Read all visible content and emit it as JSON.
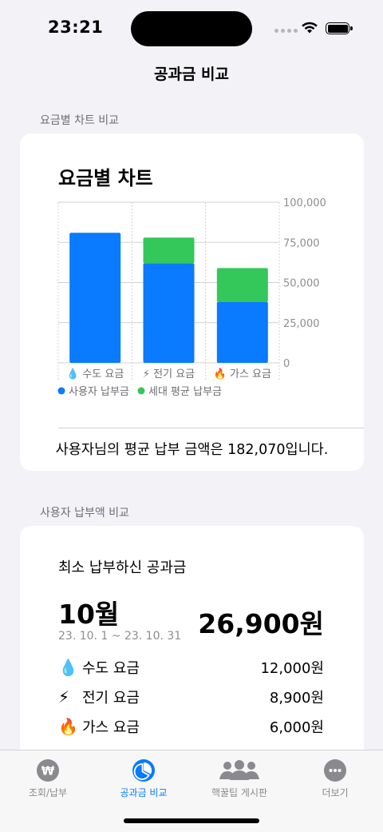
{
  "status": {
    "time": "23:21"
  },
  "nav": {
    "title": "공과금 비교"
  },
  "chart_section": {
    "label": "요금별 차트 비교",
    "summary": "사용자님의 평균 납부 금액은 182,070입니다."
  },
  "chart_data": {
    "type": "bar",
    "stacked": true,
    "title": "요금별 차트",
    "categories": [
      {
        "icon": "💧",
        "label": "수도 요금"
      },
      {
        "icon": "⚡",
        "label": "전기 요금"
      },
      {
        "icon": "🔥",
        "label": "가스 요금"
      }
    ],
    "series": [
      {
        "name": "사용자 납부금",
        "color": "#0a7aff",
        "values": [
          81000,
          62000,
          38000
        ]
      },
      {
        "name": "세대 평균 납부금",
        "color": "#34c759",
        "values": [
          0,
          16000,
          21000
        ]
      }
    ],
    "ylim": [
      0,
      100000
    ],
    "y_ticks": [
      "100,000",
      "75,000",
      "50,000",
      "25,000",
      "0"
    ],
    "y_tick_values": [
      100000,
      75000,
      50000,
      25000,
      0
    ],
    "grid": true,
    "legend_position": "bottom-left"
  },
  "payment_section": {
    "label": "사용자 납부액 비교",
    "card_title": "최소 납부하신 공과금",
    "month": "10월",
    "period": "23. 10. 1 ~ 23. 10. 31",
    "total": "26,900원",
    "items": [
      {
        "icon": "💧",
        "label": "수도 요금",
        "amount": "12,000원"
      },
      {
        "icon": "⚡",
        "label": "전기 요금",
        "amount": "8,900원"
      },
      {
        "icon": "🔥",
        "label": "가스 요금",
        "amount": "6,000원"
      }
    ]
  },
  "tabs": [
    {
      "label": "조회/납부",
      "icon": "won-icon",
      "active": false
    },
    {
      "label": "공과금 비교",
      "icon": "pie-chart-icon",
      "active": true
    },
    {
      "label": "핵꿀팁 게시판",
      "icon": "people-icon",
      "active": false
    },
    {
      "label": "더보기",
      "icon": "more-icon",
      "active": false
    }
  ],
  "colors": {
    "accent": "#0a7aff",
    "green": "#34c759",
    "inactive": "#8a8a8e"
  }
}
